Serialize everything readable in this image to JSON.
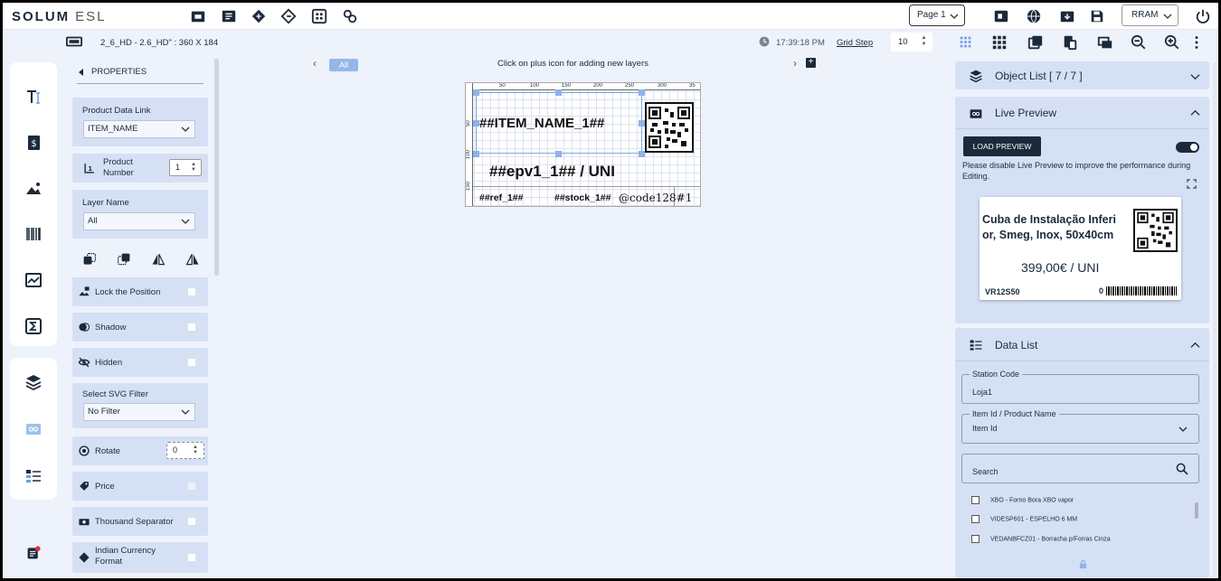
{
  "app": {
    "brand": "SOLUM",
    "brand_sub": "ESL"
  },
  "toolbar": {
    "page_select": "Page 1",
    "layout_select": "RRAM"
  },
  "subbar": {
    "template_name": "2_6_HD - 2.6_HD\" : 360 X 184",
    "time": "17:39:18 PM",
    "grid_step_label": "Grid Step",
    "grid_step_value": "10"
  },
  "properties": {
    "title": "PROPERTIES",
    "product_data_link_label": "Product Data Link",
    "product_data_link_value": "ITEM_NAME",
    "product_number_label": "Product Number",
    "product_number_value": "1",
    "layer_name_label": "Layer Name",
    "layer_name_value": "All",
    "lock_position": "Lock the Position",
    "shadow": "Shadow",
    "hidden": "Hidden",
    "svg_filter_label": "Select SVG Filter",
    "svg_filter_value": "No Filter",
    "rotate_label": "Rotate",
    "rotate_value": "0",
    "price": "Price",
    "thousand_separator": "Thousand Separator",
    "indian_currency": "Indian Currency Format"
  },
  "canvas": {
    "layer_filter": "All",
    "hint": "Click on plus icon for adding new layers",
    "ruler_top": [
      "0",
      "50",
      "100",
      "150",
      "200",
      "250",
      "300",
      "35"
    ],
    "ruler_left": [
      "50",
      "100",
      "150"
    ],
    "item_name": "##ITEM_NAME_1##",
    "price_text": "##epv1_1## / UNI",
    "ref_text": "##ref_1##",
    "stock_text": "##stock_1##",
    "barcode_text": "@code128#1"
  },
  "right_panel": {
    "object_list": "Object List [ 7 / 7 ]",
    "live_preview": "Live Preview",
    "load_preview": "LOAD PREVIEW",
    "live_note": "Please disable Live Preview to improve the performance during Editing.",
    "preview": {
      "title": "Cuba de Instalação Inferi or, Smeg, Inox, 50x40cm",
      "price": "399,00€ / UNI",
      "ref": "VR12S50",
      "stock": "0"
    },
    "data_list": "Data List",
    "station_code_label": "Station Code",
    "station_code_value": "Loja1",
    "item_id_label": "Item Id / Product Name",
    "item_id_value": "Item Id",
    "search_placeholder": "Search",
    "items": [
      "XBO - Forno Bora XBO vapor",
      "VIDESP601 - ESPELHO 6 MM",
      "VEDANBFCZ01 - Borracha p/Forras Cinza"
    ]
  }
}
